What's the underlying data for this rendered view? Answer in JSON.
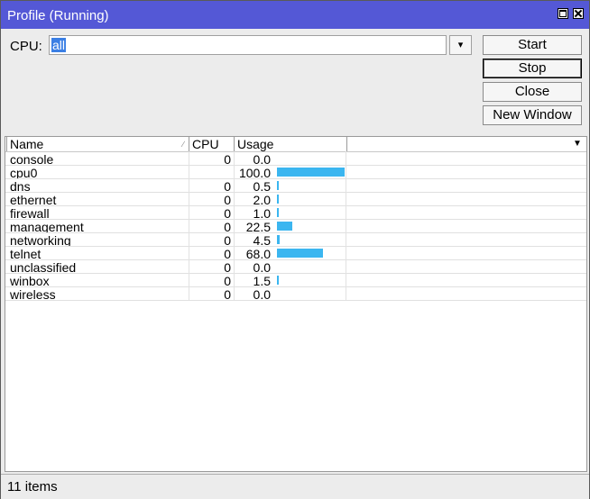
{
  "window": {
    "title": "Profile (Running)"
  },
  "cpu": {
    "label": "CPU:",
    "value": "all",
    "dropdown_glyph": "▾"
  },
  "buttons": {
    "start": "Start",
    "stop": "Stop",
    "close": "Close",
    "new_window": "New Window"
  },
  "table": {
    "columns": [
      "Name",
      "CPU",
      "Usage"
    ],
    "rows": [
      {
        "name": "console",
        "cpu": "0",
        "usage": "0.0",
        "usage_value": 0.0
      },
      {
        "name": "cpu0",
        "cpu": "",
        "usage": "100.0",
        "usage_value": 100.0
      },
      {
        "name": "dns",
        "cpu": "0",
        "usage": "0.5",
        "usage_value": 0.5
      },
      {
        "name": "ethernet",
        "cpu": "0",
        "usage": "2.0",
        "usage_value": 2.0
      },
      {
        "name": "firewall",
        "cpu": "0",
        "usage": "1.0",
        "usage_value": 1.0
      },
      {
        "name": "management",
        "cpu": "0",
        "usage": "22.5",
        "usage_value": 22.5
      },
      {
        "name": "networking",
        "cpu": "0",
        "usage": "4.5",
        "usage_value": 4.5
      },
      {
        "name": "telnet",
        "cpu": "0",
        "usage": "68.0",
        "usage_value": 68.0
      },
      {
        "name": "unclassified",
        "cpu": "0",
        "usage": "0.0",
        "usage_value": 0.0
      },
      {
        "name": "winbox",
        "cpu": "0",
        "usage": "1.5",
        "usage_value": 1.5
      },
      {
        "name": "wireless",
        "cpu": "0",
        "usage": "0.0",
        "usage_value": 0.0
      }
    ],
    "bar_color": "#3bb6f0"
  },
  "status": {
    "text": "11 items"
  },
  "colors": {
    "titlebar": "#5458d6",
    "selection": "#3b7fe4"
  }
}
